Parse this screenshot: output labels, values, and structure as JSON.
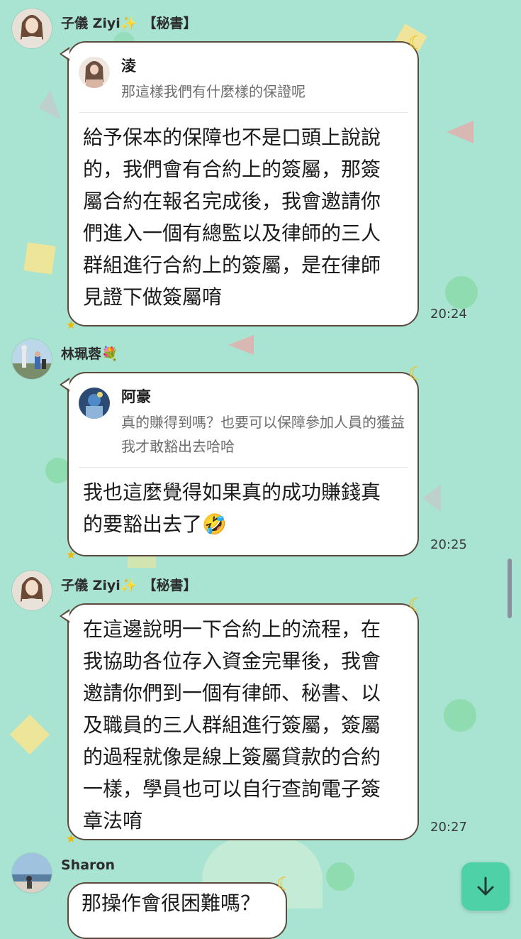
{
  "colors": {
    "background": "#a9e3d2",
    "bubble_border": "#5b4a3d",
    "bubble_bg": "#ffffff",
    "moon": "#f2c21a",
    "scroll_button": "#4fd1a7"
  },
  "messages": [
    {
      "sender": "子儀 Ziyi",
      "sender_emoji": "✨",
      "role": "【秘書】",
      "reply": {
        "name": "淩",
        "text": "那這樣我們有什麼樣的保證呢"
      },
      "text": "給予保本的保障也不是口頭上說說的，我們會有合約上的簽屬，那簽屬合約在報名完成後，我會邀請你們進入一個有總監以及律師的三人群組進行合約上的簽屬，是在律師見證下做簽屬唷",
      "time": "20:24"
    },
    {
      "sender": "林珮蓉",
      "sender_emoji": "💐",
      "reply": {
        "name": "阿豪",
        "text": "真的賺得到嗎？也要可以保障參加人員的獲益我才敢豁出去哈哈"
      },
      "text": "我也這麼覺得如果真的成功賺錢真的要豁出去了",
      "text_emoji": "🤣",
      "time": "20:25"
    },
    {
      "sender": "子儀 Ziyi",
      "sender_emoji": "✨",
      "role": "【秘書】",
      "text": "在這邊說明一下合約上的流程，在我協助各位存入資金完畢後，我會邀請你們到一個有律師、秘書、以及職員的三人群組進行簽屬，簽屬的過程就像是線上簽屬貸款的合約一樣，學員也可以自行查詢電子簽章法唷",
      "time": "20:27"
    },
    {
      "sender": "Sharon",
      "text": "那操作會很困難嗎？"
    }
  ],
  "icons": {
    "scroll_down": "arrow-down-icon",
    "moon": "moon-icon",
    "star": "star-icon"
  }
}
